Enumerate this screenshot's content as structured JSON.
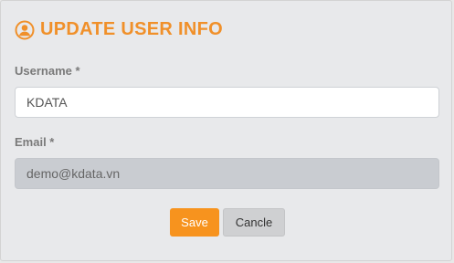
{
  "form": {
    "title": "UPDATE USER INFO",
    "title_icon": "user-circle-icon",
    "username_label": "Username *",
    "username_value": "KDATA",
    "email_label": "Email *",
    "email_value": "demo@kdata.vn",
    "save_label": "Save",
    "cancel_label": "Cancle"
  },
  "colors": {
    "accent": "#f7931e",
    "title": "#f0902a",
    "disabled_field": "#c9ccd1",
    "cancel_button": "#cfd0d2"
  }
}
